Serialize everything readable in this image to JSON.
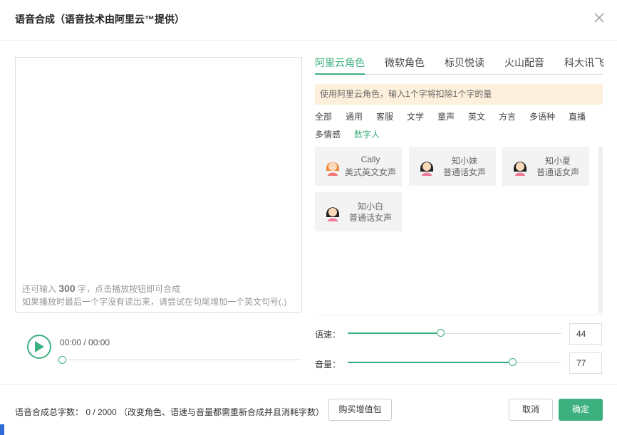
{
  "dialog": {
    "title": "语音合成（语音技术由阿里云™提供）",
    "close_icon": "close-icon"
  },
  "editor": {
    "hint_prefix": "还可输入",
    "remaining": "300",
    "hint_suffix": "字，点击播放按钮即可合成",
    "hint_line2": "如果播放时最后一个字没有读出来，请尝试在句尾增加一个英文句号(.)"
  },
  "player": {
    "play_icon": "play-icon",
    "time": "00:00 / 00:00",
    "progress": 0
  },
  "tabs": [
    {
      "label": "阿里云角色",
      "active": true
    },
    {
      "label": "微软角色",
      "active": false
    },
    {
      "label": "标贝悦读",
      "active": false
    },
    {
      "label": "火山配音",
      "active": false
    },
    {
      "label": "科大讯飞",
      "active": false
    }
  ],
  "notice": "使用阿里云角色，输入1个字将扣除1个字的量",
  "categories": [
    {
      "label": "全部",
      "active": false
    },
    {
      "label": "通用",
      "active": false
    },
    {
      "label": "客服",
      "active": false
    },
    {
      "label": "文学",
      "active": false
    },
    {
      "label": "童声",
      "active": false
    },
    {
      "label": "英文",
      "active": false
    },
    {
      "label": "方言",
      "active": false
    },
    {
      "label": "多语种",
      "active": false
    },
    {
      "label": "直播",
      "active": false
    },
    {
      "label": "多情感",
      "active": false
    },
    {
      "label": "数字人",
      "active": true
    }
  ],
  "voices": [
    {
      "name": "Cally",
      "desc": "美式英文女声",
      "avatar": "orange-hair-girl-avatar-icon"
    },
    {
      "name": "知小妹",
      "desc": "普通话女声",
      "avatar": "girl-avatar-icon"
    },
    {
      "name": "知小夏",
      "desc": "普通话女声",
      "avatar": "girl-avatar-icon"
    },
    {
      "name": "知小白",
      "desc": "普通话女声",
      "avatar": "girl-avatar-icon"
    }
  ],
  "speed": {
    "label": "语速：",
    "value": "44"
  },
  "volume": {
    "label": "音量：",
    "value": "77"
  },
  "footer": {
    "total": "语音合成总字数： 0 / 2000 （改变角色、语速与音量都需重新合成并且消耗字数）",
    "buy": "购买增值包",
    "cancel": "取消",
    "ok": "确定"
  },
  "colors": {
    "accent": "#3db07f",
    "notice_bg": "#fdf0dc"
  }
}
